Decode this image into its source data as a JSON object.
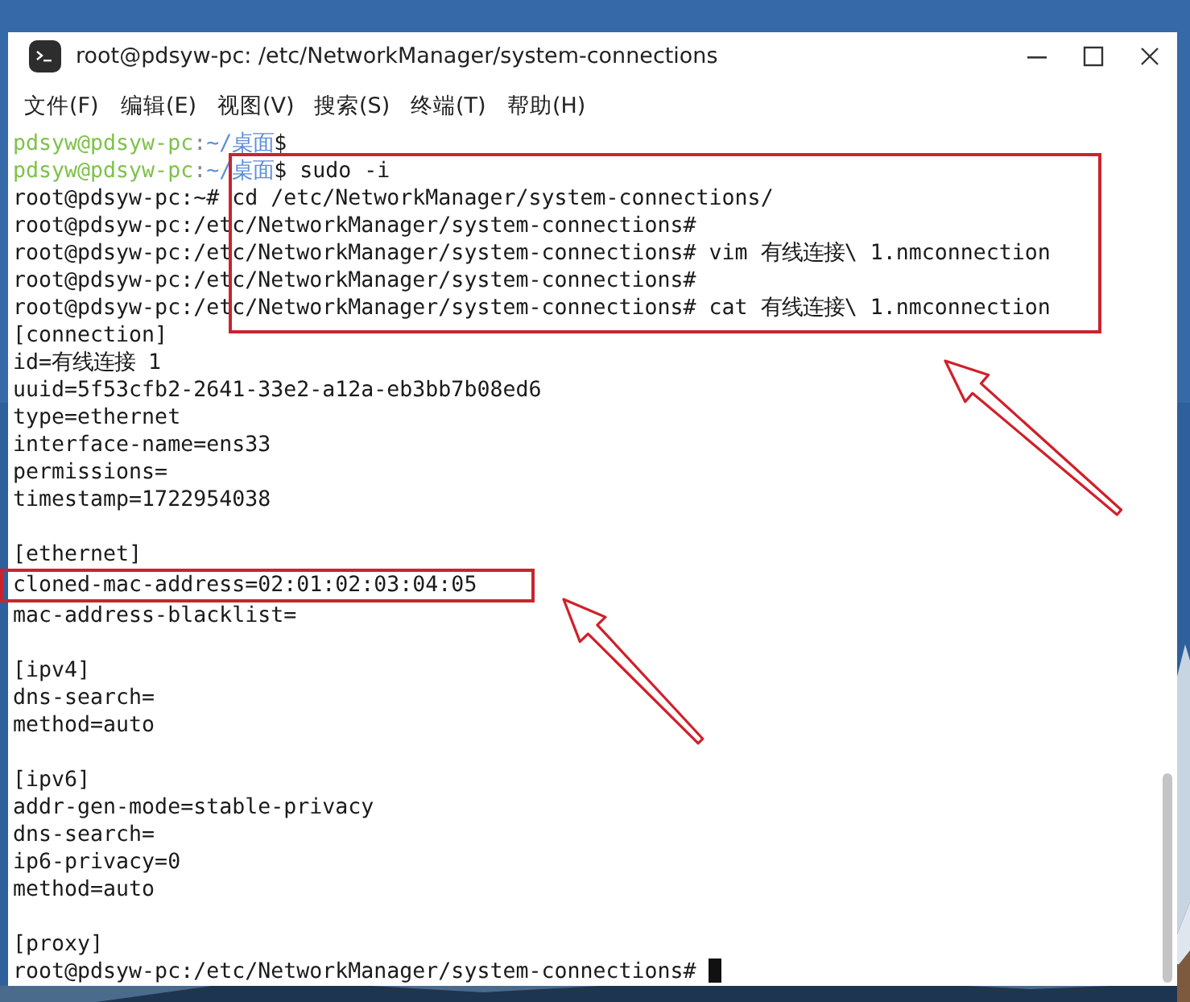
{
  "window": {
    "title": "root@pdsyw-pc: /etc/NetworkManager/system-connections",
    "controls": [
      {
        "kind": "minimize"
      },
      {
        "kind": "maximize"
      },
      {
        "kind": "close"
      }
    ]
  },
  "menu": [
    "文件(F)",
    "编辑(E)",
    "视图(V)",
    "搜索(S)",
    "终端(T)",
    "帮助(H)"
  ],
  "terminal": {
    "lines": [
      {
        "kind": "prompt",
        "segments": [
          {
            "kind": "user",
            "text": "pdsyw@pdsyw-pc"
          },
          {
            "kind": "sep",
            "text": ":"
          },
          {
            "kind": "path",
            "text": "~/桌面"
          },
          {
            "kind": "plain",
            "text": "$"
          }
        ]
      },
      {
        "kind": "prompt",
        "segments": [
          {
            "kind": "user",
            "text": "pdsyw@pdsyw-pc"
          },
          {
            "kind": "sep",
            "text": ":"
          },
          {
            "kind": "path",
            "text": "~/桌面"
          },
          {
            "kind": "plain",
            "text": "$ sudo -i"
          }
        ]
      },
      {
        "kind": "text",
        "text": "root@pdsyw-pc:~# cd /etc/NetworkManager/system-connections/"
      },
      {
        "kind": "text",
        "text": "root@pdsyw-pc:/etc/NetworkManager/system-connections#"
      },
      {
        "kind": "text",
        "text": "root@pdsyw-pc:/etc/NetworkManager/system-connections# vim 有线连接\\ 1.nmconnection"
      },
      {
        "kind": "text",
        "text": "root@pdsyw-pc:/etc/NetworkManager/system-connections#"
      },
      {
        "kind": "text",
        "text": "root@pdsyw-pc:/etc/NetworkManager/system-connections# cat 有线连接\\ 1.nmconnection"
      },
      {
        "kind": "text",
        "text": "[connection]"
      },
      {
        "kind": "text",
        "text": "id=有线连接 1"
      },
      {
        "kind": "text",
        "text": "uuid=5f53cfb2-2641-33e2-a12a-eb3bb7b08ed6"
      },
      {
        "kind": "text",
        "text": "type=ethernet"
      },
      {
        "kind": "text",
        "text": "interface-name=ens33"
      },
      {
        "kind": "text",
        "text": "permissions="
      },
      {
        "kind": "text",
        "text": "timestamp=1722954038"
      },
      {
        "kind": "blank"
      },
      {
        "kind": "text",
        "text": "[ethernet]"
      },
      {
        "kind": "text",
        "text": "cloned-mac-address=02:01:02:03:04:05",
        "highlighted": true
      },
      {
        "kind": "text",
        "text": "mac-address-blacklist="
      },
      {
        "kind": "blank"
      },
      {
        "kind": "text",
        "text": "[ipv4]"
      },
      {
        "kind": "text",
        "text": "dns-search="
      },
      {
        "kind": "text",
        "text": "method=auto"
      },
      {
        "kind": "blank"
      },
      {
        "kind": "text",
        "text": "[ipv6]"
      },
      {
        "kind": "text",
        "text": "addr-gen-mode=stable-privacy"
      },
      {
        "kind": "text",
        "text": "dns-search="
      },
      {
        "kind": "text",
        "text": "ip6-privacy=0"
      },
      {
        "kind": "text",
        "text": "method=auto"
      },
      {
        "kind": "blank"
      },
      {
        "kind": "text",
        "text": "[proxy]"
      },
      {
        "kind": "text",
        "text": "root@pdsyw-pc:/etc/NetworkManager/system-connections#",
        "cursor": true
      }
    ]
  }
}
